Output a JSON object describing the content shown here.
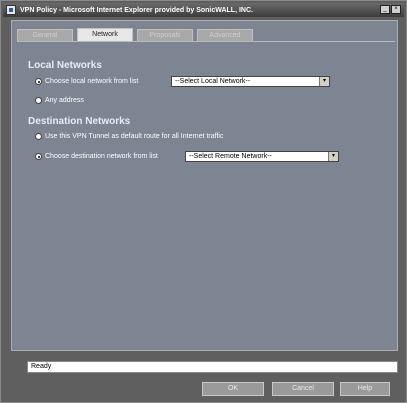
{
  "window": {
    "title": "VPN Policy - Microsoft Internet Explorer provided by SonicWALL, INC.",
    "controls": [
      "_",
      "×"
    ]
  },
  "tabs": [
    {
      "label": "General",
      "active": false
    },
    {
      "label": "Network",
      "active": true
    },
    {
      "label": "Proposals",
      "active": false
    },
    {
      "label": "Advanced",
      "active": false
    }
  ],
  "local_networks": {
    "heading": "Local Networks",
    "option_choose_label": "Choose local network from list",
    "option_choose_checked": true,
    "select_value": "--Select Local Network--",
    "option_any_label": "Any address",
    "option_any_checked": false
  },
  "destination_networks": {
    "heading": "Destination Networks",
    "option_default_route_label": "Use this VPN Tunnel as default route for all Internet traffic",
    "option_default_route_checked": false,
    "option_choose_label": "Choose destination network from list",
    "option_choose_checked": true,
    "select_value": "--Select Remote Network--"
  },
  "status": {
    "text": "Ready"
  },
  "buttons": {
    "ok": "OK",
    "cancel": "Cancel",
    "help": "Help"
  },
  "icons": {
    "select_arrow": "▾"
  }
}
